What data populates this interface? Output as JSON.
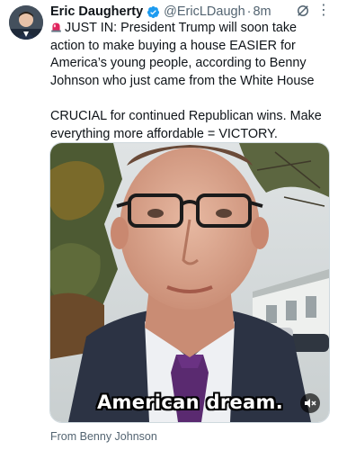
{
  "author": {
    "name": "Eric Daugherty",
    "handle": "@EricLDaugh",
    "separator": "·",
    "time": "8m",
    "verified": true,
    "verified_color": "#1d9bf0"
  },
  "tweet": {
    "line1": "JUST IN: President Trump will soon take action to make buying a house EASIER for America’s young people, according to Benny Johnson who just came from the White House",
    "line2": "CRUCIAL for continued Republican wins. Make everything more affordable = VICTORY.",
    "emoji_icon": "siren-icon"
  },
  "media": {
    "caption": "American dream.",
    "mute_icon": "speaker-muted-icon"
  },
  "source": "From Benny Johnson",
  "icons": {
    "grok": "grok-icon",
    "more": "more-icon"
  },
  "colors": {
    "text": "#0f1419",
    "secondary": "#536471"
  }
}
